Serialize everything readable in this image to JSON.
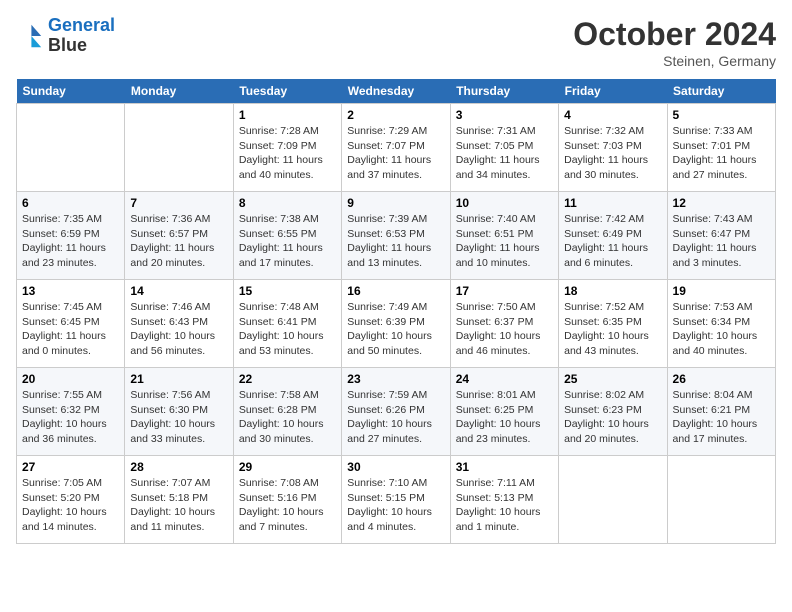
{
  "header": {
    "logo_line1": "General",
    "logo_line2": "Blue",
    "month_title": "October 2024",
    "location": "Steinen, Germany"
  },
  "days_of_week": [
    "Sunday",
    "Monday",
    "Tuesday",
    "Wednesday",
    "Thursday",
    "Friday",
    "Saturday"
  ],
  "weeks": [
    [
      {
        "day": "",
        "empty": true
      },
      {
        "day": "",
        "empty": true
      },
      {
        "day": "1",
        "sunrise": "Sunrise: 7:28 AM",
        "sunset": "Sunset: 7:09 PM",
        "daylight": "Daylight: 11 hours and 40 minutes."
      },
      {
        "day": "2",
        "sunrise": "Sunrise: 7:29 AM",
        "sunset": "Sunset: 7:07 PM",
        "daylight": "Daylight: 11 hours and 37 minutes."
      },
      {
        "day": "3",
        "sunrise": "Sunrise: 7:31 AM",
        "sunset": "Sunset: 7:05 PM",
        "daylight": "Daylight: 11 hours and 34 minutes."
      },
      {
        "day": "4",
        "sunrise": "Sunrise: 7:32 AM",
        "sunset": "Sunset: 7:03 PM",
        "daylight": "Daylight: 11 hours and 30 minutes."
      },
      {
        "day": "5",
        "sunrise": "Sunrise: 7:33 AM",
        "sunset": "Sunset: 7:01 PM",
        "daylight": "Daylight: 11 hours and 27 minutes."
      }
    ],
    [
      {
        "day": "6",
        "sunrise": "Sunrise: 7:35 AM",
        "sunset": "Sunset: 6:59 PM",
        "daylight": "Daylight: 11 hours and 23 minutes."
      },
      {
        "day": "7",
        "sunrise": "Sunrise: 7:36 AM",
        "sunset": "Sunset: 6:57 PM",
        "daylight": "Daylight: 11 hours and 20 minutes."
      },
      {
        "day": "8",
        "sunrise": "Sunrise: 7:38 AM",
        "sunset": "Sunset: 6:55 PM",
        "daylight": "Daylight: 11 hours and 17 minutes."
      },
      {
        "day": "9",
        "sunrise": "Sunrise: 7:39 AM",
        "sunset": "Sunset: 6:53 PM",
        "daylight": "Daylight: 11 hours and 13 minutes."
      },
      {
        "day": "10",
        "sunrise": "Sunrise: 7:40 AM",
        "sunset": "Sunset: 6:51 PM",
        "daylight": "Daylight: 11 hours and 10 minutes."
      },
      {
        "day": "11",
        "sunrise": "Sunrise: 7:42 AM",
        "sunset": "Sunset: 6:49 PM",
        "daylight": "Daylight: 11 hours and 6 minutes."
      },
      {
        "day": "12",
        "sunrise": "Sunrise: 7:43 AM",
        "sunset": "Sunset: 6:47 PM",
        "daylight": "Daylight: 11 hours and 3 minutes."
      }
    ],
    [
      {
        "day": "13",
        "sunrise": "Sunrise: 7:45 AM",
        "sunset": "Sunset: 6:45 PM",
        "daylight": "Daylight: 11 hours and 0 minutes."
      },
      {
        "day": "14",
        "sunrise": "Sunrise: 7:46 AM",
        "sunset": "Sunset: 6:43 PM",
        "daylight": "Daylight: 10 hours and 56 minutes."
      },
      {
        "day": "15",
        "sunrise": "Sunrise: 7:48 AM",
        "sunset": "Sunset: 6:41 PM",
        "daylight": "Daylight: 10 hours and 53 minutes."
      },
      {
        "day": "16",
        "sunrise": "Sunrise: 7:49 AM",
        "sunset": "Sunset: 6:39 PM",
        "daylight": "Daylight: 10 hours and 50 minutes."
      },
      {
        "day": "17",
        "sunrise": "Sunrise: 7:50 AM",
        "sunset": "Sunset: 6:37 PM",
        "daylight": "Daylight: 10 hours and 46 minutes."
      },
      {
        "day": "18",
        "sunrise": "Sunrise: 7:52 AM",
        "sunset": "Sunset: 6:35 PM",
        "daylight": "Daylight: 10 hours and 43 minutes."
      },
      {
        "day": "19",
        "sunrise": "Sunrise: 7:53 AM",
        "sunset": "Sunset: 6:34 PM",
        "daylight": "Daylight: 10 hours and 40 minutes."
      }
    ],
    [
      {
        "day": "20",
        "sunrise": "Sunrise: 7:55 AM",
        "sunset": "Sunset: 6:32 PM",
        "daylight": "Daylight: 10 hours and 36 minutes."
      },
      {
        "day": "21",
        "sunrise": "Sunrise: 7:56 AM",
        "sunset": "Sunset: 6:30 PM",
        "daylight": "Daylight: 10 hours and 33 minutes."
      },
      {
        "day": "22",
        "sunrise": "Sunrise: 7:58 AM",
        "sunset": "Sunset: 6:28 PM",
        "daylight": "Daylight: 10 hours and 30 minutes."
      },
      {
        "day": "23",
        "sunrise": "Sunrise: 7:59 AM",
        "sunset": "Sunset: 6:26 PM",
        "daylight": "Daylight: 10 hours and 27 minutes."
      },
      {
        "day": "24",
        "sunrise": "Sunrise: 8:01 AM",
        "sunset": "Sunset: 6:25 PM",
        "daylight": "Daylight: 10 hours and 23 minutes."
      },
      {
        "day": "25",
        "sunrise": "Sunrise: 8:02 AM",
        "sunset": "Sunset: 6:23 PM",
        "daylight": "Daylight: 10 hours and 20 minutes."
      },
      {
        "day": "26",
        "sunrise": "Sunrise: 8:04 AM",
        "sunset": "Sunset: 6:21 PM",
        "daylight": "Daylight: 10 hours and 17 minutes."
      }
    ],
    [
      {
        "day": "27",
        "sunrise": "Sunrise: 7:05 AM",
        "sunset": "Sunset: 5:20 PM",
        "daylight": "Daylight: 10 hours and 14 minutes."
      },
      {
        "day": "28",
        "sunrise": "Sunrise: 7:07 AM",
        "sunset": "Sunset: 5:18 PM",
        "daylight": "Daylight: 10 hours and 11 minutes."
      },
      {
        "day": "29",
        "sunrise": "Sunrise: 7:08 AM",
        "sunset": "Sunset: 5:16 PM",
        "daylight": "Daylight: 10 hours and 7 minutes."
      },
      {
        "day": "30",
        "sunrise": "Sunrise: 7:10 AM",
        "sunset": "Sunset: 5:15 PM",
        "daylight": "Daylight: 10 hours and 4 minutes."
      },
      {
        "day": "31",
        "sunrise": "Sunrise: 7:11 AM",
        "sunset": "Sunset: 5:13 PM",
        "daylight": "Daylight: 10 hours and 1 minute."
      },
      {
        "day": "",
        "empty": true
      },
      {
        "day": "",
        "empty": true
      }
    ]
  ]
}
